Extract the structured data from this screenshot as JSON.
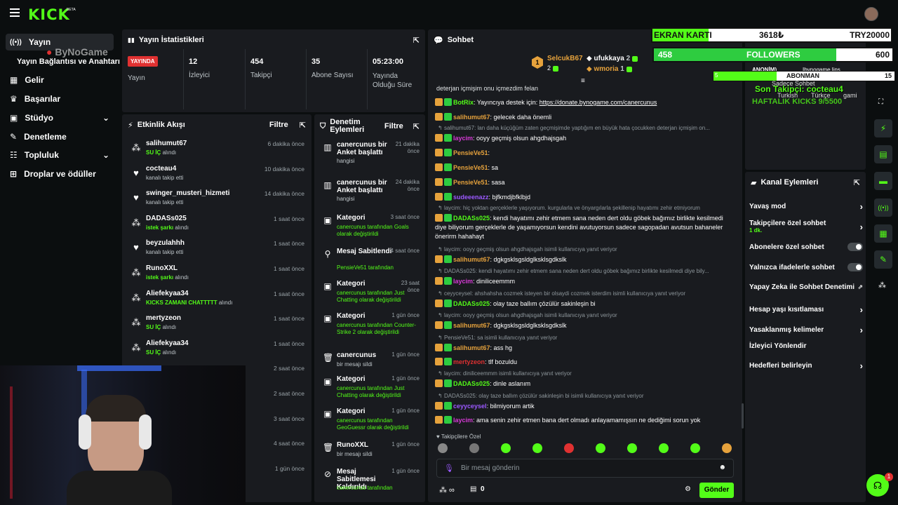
{
  "header": {
    "logo": "KICK",
    "beta": "BETA"
  },
  "sidebar": {
    "items": [
      {
        "label": "Yayın",
        "icon": "broadcast-icon"
      },
      {
        "label": "Yayın Bağlantısı ve Anahtarı"
      },
      {
        "label": "Gelir",
        "icon": "revenue-icon"
      },
      {
        "label": "Başarılar",
        "icon": "trophy-icon"
      },
      {
        "label": "Stüdyo",
        "icon": "studio-icon"
      },
      {
        "label": "Denetleme",
        "icon": "wrench-icon"
      },
      {
        "label": "Topluluk",
        "icon": "community-icon"
      },
      {
        "label": "Droplar ve ödüller",
        "icon": "drops-icon"
      }
    ]
  },
  "stats": {
    "title": "Yayın İstatistikleri",
    "live_badge": "YAYINDA",
    "items": [
      {
        "value": "",
        "label": "Yayın"
      },
      {
        "value": "12",
        "label": "İzleyici"
      },
      {
        "value": "454",
        "label": "Takipçi"
      },
      {
        "value": "35",
        "label": "Abone Sayısı"
      },
      {
        "value": "05:23:00",
        "label": "Yayında Olduğu Süre"
      }
    ]
  },
  "activity": {
    "title": "Etkinlik Akışı",
    "filter": "Filtre",
    "rows": [
      {
        "name": "salihumut67",
        "sub_green": "SU İÇ",
        "sub": " alındı",
        "time": "6 dakika önce"
      },
      {
        "name": "cocteau4",
        "sub_green": "",
        "sub": "kanalı takip etti",
        "time": "10 dakika önce"
      },
      {
        "name": "swinger_musteri_hizmeti",
        "sub_green": "",
        "sub": "kanalı takip etti",
        "time": "14 dakika önce"
      },
      {
        "name": "DADASs025",
        "sub_green": "istek şarkı",
        "sub": " alındı",
        "time": "1 saat önce"
      },
      {
        "name": "beyzulahhh",
        "sub_green": "",
        "sub": "kanalı takip etti",
        "time": "1 saat önce"
      },
      {
        "name": "RunoXXL",
        "sub_green": "istek şarkı",
        "sub": " alındı",
        "time": "1 saat önce"
      },
      {
        "name": "Aliefekyaa34",
        "sub_green": "KICKS ZAMANI CHATTTTT",
        "sub": " alındı",
        "time": "1 saat önce"
      },
      {
        "name": "mertyzeon",
        "sub_green": "SU İÇ",
        "sub": " alındı",
        "time": "1 saat önce"
      },
      {
        "name": "Aliefekyaa34",
        "sub_green": "SU İÇ",
        "sub": " alındı",
        "time": "1 saat önce"
      },
      {
        "name": "",
        "sub_green": "",
        "sub": "",
        "time": "2 saat önce"
      },
      {
        "name": "",
        "sub_green": "",
        "sub": "",
        "time": "2 saat önce"
      },
      {
        "name": "",
        "sub_green": "",
        "sub": "",
        "time": "3 saat önce"
      },
      {
        "name": "",
        "sub_green": "",
        "sub": "",
        "time": "4 saat önce"
      },
      {
        "name": "",
        "sub_green": "",
        "sub": "",
        "time": "1 gün önce"
      }
    ]
  },
  "moderation": {
    "title": "Denetim Eylemleri",
    "filter": "Filtre",
    "rows": [
      {
        "icon": "chart-icon",
        "title": "canercunus bir Anket başlattı",
        "sub": "hangisi",
        "time": "21 dakika önce"
      },
      {
        "icon": "chart-icon",
        "title": "canercunus bir Anket başlattı",
        "sub": "hangisi",
        "time": "24 dakika önce"
      },
      {
        "icon": "category-icon",
        "title": "Kategori",
        "sub": "canercunus tarafından Goals olarak değiştirildi",
        "time": "3 saat önce"
      },
      {
        "icon": "pin-icon",
        "title": "Mesaj Sabitlendi",
        "sub": "PensieVe51 tarafından",
        "time": "4 saat önce"
      },
      {
        "icon": "category-icon",
        "title": "Kategori",
        "sub": "canercunus tarafından Just Chatting olarak değiştirildi",
        "time": "23 saat önce"
      },
      {
        "icon": "category-icon",
        "title": "Kategori",
        "sub": "canercunus tarafından Counter-Strike 2 olarak değiştirildi",
        "time": "1 gün önce"
      },
      {
        "icon": "trash-icon",
        "title": "canercunus",
        "sub": "bir mesajı sildi",
        "time": "1 gün önce"
      },
      {
        "icon": "category-icon",
        "title": "Kategori",
        "sub": "canercunus tarafından Just Chatting olarak değiştirildi",
        "time": "1 gün önce"
      },
      {
        "icon": "category-icon",
        "title": "Kategori",
        "sub": "canercunus tarafından GeoGuessr olarak değiştirildi",
        "time": "1 gün önce"
      },
      {
        "icon": "trash-icon",
        "title": "RunoXXL",
        "sub": "bir mesajı sildi",
        "time": "1 gün önce"
      },
      {
        "icon": "unpin-icon",
        "title": "Mesaj Sabitlemesi Kaldırıldı",
        "sub": "canercunus tarafından",
        "time": "1 gün önce"
      }
    ]
  },
  "chat": {
    "title": "Sohbet",
    "top_gifters": [
      {
        "rank": "1",
        "name": "SelcukB67",
        "count": "2"
      },
      {
        "name": "ufukkaya",
        "count": "2"
      },
      {
        "name": "wmoria",
        "count": "1"
      }
    ],
    "pinned_tail": "deterjan içmişim onu içmezdim felan",
    "lines": [
      {
        "reply": "",
        "user": "BotRix",
        "ucolor": "#53fc18",
        "text": ": Yayıncıya destek için: ",
        "link": "https://donate.bynogame.com/canercunus"
      },
      {
        "reply": "",
        "user": "salihumut67",
        "ucolor": "#e6a23c",
        "text": ": gelecek daha önemli",
        "link": ""
      },
      {
        "reply": "salihumut67: lan daha küçüğüm zaten geçmişimde yaptığım en büyük hata çocukken deterjan içmişim on...",
        "user": "laycim",
        "ucolor": "#d63ad6",
        "text": ": ooyy geçmiş olsun ahgdhajsgah",
        "link": ""
      },
      {
        "reply": "",
        "user": "PensieVe51",
        "ucolor": "#e6a23c",
        "text": ":",
        "link": ""
      },
      {
        "reply": "",
        "user": "PensieVe51",
        "ucolor": "#e6a23c",
        "text": ": sa",
        "link": ""
      },
      {
        "reply": "",
        "user": "PensieVe51",
        "ucolor": "#e6a23c",
        "text": ": sasa",
        "link": ""
      },
      {
        "reply": "",
        "user": "sudeeenazz",
        "ucolor": "#9b59ff",
        "text": ": bjfkmdjbfklbjd",
        "link": ""
      },
      {
        "reply": "laycim: hiç yoktan gerçeklerle yaşıyorum. kurgularla ve önyargılarla şekillenip hayatımı zehir etmiyorum",
        "user": "DADASs025",
        "ucolor": "#53fc18",
        "text": ": kendi hayatımı zehir etmem sana neden dert oldu göbek bağımız birlikte kesilmedi diye biliyorum gerçeklerle de yaşamıyorsun kendini avutuyorsun sadece sagopadan avutsun bahaneler önerirm hahahayt",
        "link": ""
      },
      {
        "reply": "laycim: ooyy geçmiş olsun ahgdhajsgah isimli kullanıcıya yanıt veriyor",
        "user": "salihumut67",
        "ucolor": "#e6a23c",
        "text": ": dgkgsklsgsldglksklsgdkslk",
        "link": ""
      },
      {
        "reply": "DADASs025: kendi hayatımı zehir etmem sana neden dert oldu göbek bağımız birlikte kesilmedi diye bily...",
        "user": "laycim",
        "ucolor": "#d63ad6",
        "text": ": diniliceemmm",
        "link": ""
      },
      {
        "reply": "ceyyceysel: ahshahsha cozmek isteyen bir olsaydi cozmek isterdim isimli kullanıcıya yanıt veriyor",
        "user": "DADASs025",
        "ucolor": "#53fc18",
        "text": ": olay taze ballım çözülür sakinleşin bi",
        "link": ""
      },
      {
        "reply": "laycim: ooyy geçmiş olsun ahgdhajsgah isimli kullanıcıya yanıt veriyor",
        "user": "salihumut67",
        "ucolor": "#e6a23c",
        "text": ": dgkgsklsgsldglksklsgdkslk",
        "link": ""
      },
      {
        "reply": "PensieVe51: sa isimli kullanıcıya yanıt veriyor",
        "user": "salihumut67",
        "ucolor": "#e6a23c",
        "text": ": ass hg",
        "link": ""
      },
      {
        "reply": "",
        "user": "mertyzeon",
        "ucolor": "#e03131",
        "text": ": tlf bozuldu",
        "link": ""
      },
      {
        "reply": "laycim: diniliceemmm isimli kullanıcıya yanıt veriyor",
        "user": "DADASs025",
        "ucolor": "#53fc18",
        "text": ": dinle aslanım",
        "link": ""
      },
      {
        "reply": "DADASs025: olay taze ballım çözülür sakinleşin bi isimli kullanıcıya yanıt veriyor",
        "user": "ceyyceysel",
        "ucolor": "#9b59ff",
        "text": ": bilmiyorum artik",
        "link": ""
      },
      {
        "reply": "",
        "user": "laycim",
        "ucolor": "#d63ad6",
        "text": ": ama senin zehir etmen bana dert olmadı anlayamamışsın ne dediğimi sorun yok",
        "link": ""
      }
    ],
    "follower_only": "Takipçilere Özel",
    "input_placeholder": "Bir mesaj gönderin",
    "kicks_count": "0",
    "send": "Gönder"
  },
  "channel_actions": {
    "title": "Kanal Eylemleri",
    "items": [
      {
        "label": "Yavaş mod",
        "type": "chevron"
      },
      {
        "label": "Takipçilere özel sohbet",
        "sub": "1 dk.",
        "type": "chevron"
      },
      {
        "label": "Abonelere özel sohbet",
        "type": "toggle"
      },
      {
        "label": "Yalnızca ifadelerle sohbet",
        "type": "toggle"
      },
      {
        "label": "Yapay Zeka ile Sohbet Denetimi",
        "type": "external"
      },
      {
        "label": "Hesap yaşı kısıtlaması",
        "type": "chevron"
      },
      {
        "label": "Yasaklanmış kelimeler",
        "type": "chevron"
      },
      {
        "label": "İzleyici Yönlendir",
        "type": "none"
      },
      {
        "label": "Hedefleri belirleyin",
        "type": "chevron"
      }
    ]
  },
  "overlay": {
    "ekran_label": "EKRAN KARTI",
    "ekran_value": "3618₺",
    "ekran_target": "TRY20000",
    "followers_left": "458",
    "followers_label": "FOLLOWERS",
    "followers_right": "600",
    "abone_left": "5",
    "abone_label": "ABONMAN",
    "abone_right": "15",
    "son_takipci": "Son Takipçi: cocteau4",
    "haftalik": "HAFTALIK KICKS 9/5500",
    "bynogame": "ByNoGame",
    "sadece": "Sadece Sohbet",
    "turkish": "Turkish",
    "turkce": "Türkçe",
    "gami": "gami",
    "anonim": "ANONİM)",
    "ibyno": "Ibynogame lins..."
  },
  "support_badge": "1"
}
